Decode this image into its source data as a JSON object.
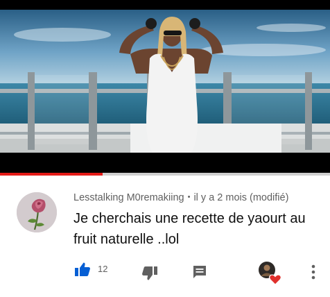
{
  "video": {
    "progress_percent": 31,
    "thumbnail": "music-video-frame-woman-on-rooftop-by-the-sea"
  },
  "comment": {
    "author": "Lesstalking M0remakiing",
    "separator": "•",
    "timestamp": "il y a 2 mois (modifié)",
    "text": "Je cherchais une recette de yaourt au fruit naturelle ..lol",
    "like_count": "12",
    "avatar_icon": "rose-avatar",
    "hearted_icon": "creator-heart-icon"
  },
  "colors": {
    "like_blue": "#065fd4",
    "heart_red": "#e0302c",
    "progress_red": "#e41b17",
    "icon_gray": "#606060"
  }
}
